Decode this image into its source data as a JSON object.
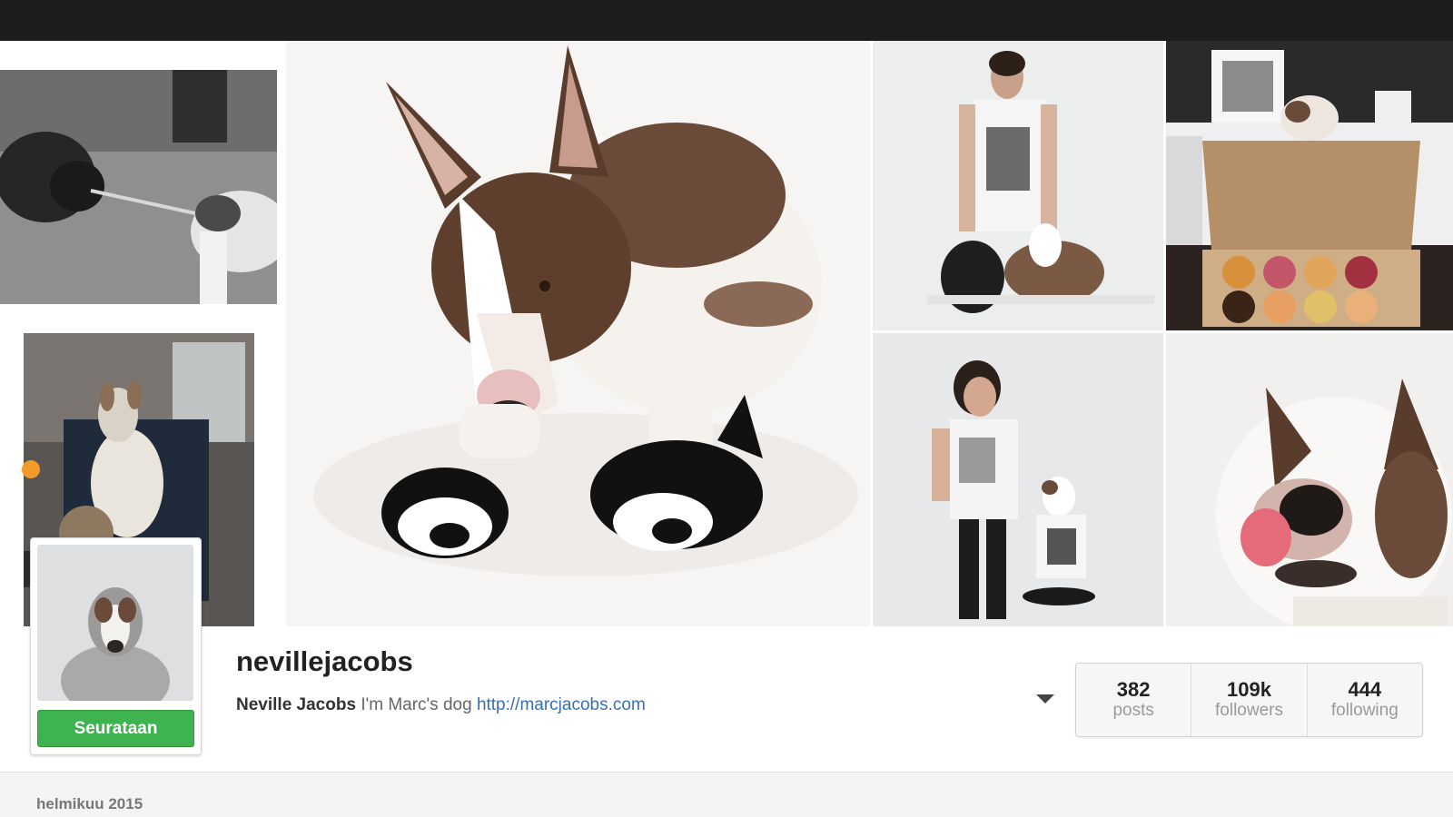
{
  "profile": {
    "username": "nevillejacobs",
    "full_name": "Neville Jacobs",
    "bio_text": "I'm Marc's dog",
    "website": "http://marcjacobs.com",
    "follow_button_label": "Seurataan"
  },
  "stats": [
    {
      "value": "382",
      "label": "posts"
    },
    {
      "value": "109k",
      "label": "followers"
    },
    {
      "value": "444",
      "label": "following"
    }
  ],
  "timeline": {
    "date_label": "helmikuu 2015"
  },
  "colors": {
    "topbar": "#1d1d1d",
    "follow_green": "#3fb34f",
    "link_blue": "#3b6fb0"
  },
  "icons": [
    "dropdown-caret-icon"
  ]
}
